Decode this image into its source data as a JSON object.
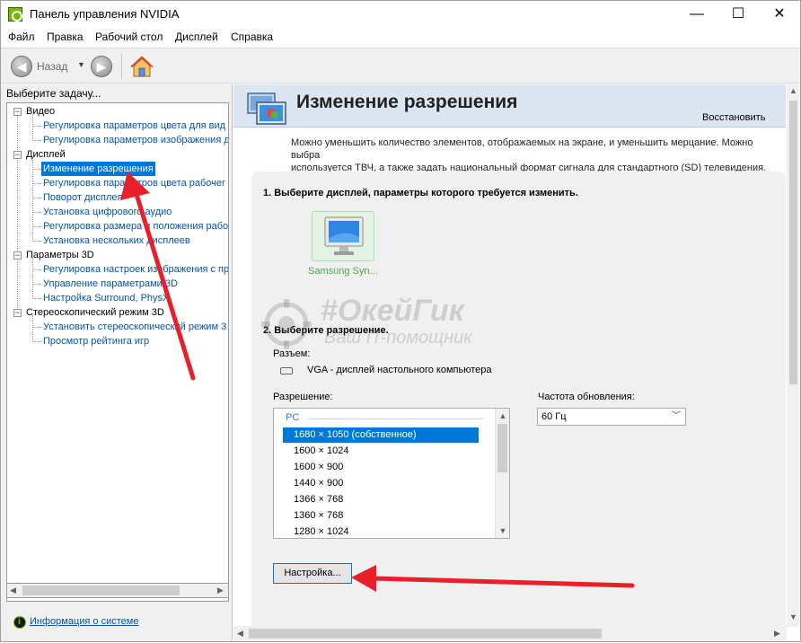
{
  "window": {
    "title": "Панель управления NVIDIA",
    "minimize_glyph": "—",
    "maximize_glyph": "☐",
    "close_glyph": "✕"
  },
  "menu": [
    "Файл",
    "Правка",
    "Рабочий стол",
    "Дисплей",
    "Справка"
  ],
  "toolbar": {
    "back_label": "Назад",
    "back_glyph": "◀",
    "forward_glyph": "▶",
    "dropdown_glyph": "▼"
  },
  "left_pane": {
    "task_label": "Выберите задачу...",
    "tree": [
      {
        "label": "Видео",
        "items": [
          "Регулировка параметров цвета для вид",
          "Регулировка параметров изображения д"
        ]
      },
      {
        "label": "Дисплей",
        "items": [
          "Изменение разрешения",
          "Регулировка параметров цвета рабочег",
          "Поворот дисплея",
          "Установка цифрового аудио",
          "Регулировка размера и положения рабо",
          "Установка нескольких дисплеев"
        ]
      },
      {
        "label": "Параметры 3D",
        "items": [
          "Регулировка настроек изображения с пр",
          "Управление параметрами 3D",
          "Настройка Surround, PhysX"
        ]
      },
      {
        "label": "Стереоскопический режим 3D",
        "items": [
          "Установить стереоскопический режим 3",
          "Просмотр рейтинга игр"
        ]
      }
    ],
    "selected_item": "Изменение разрешения",
    "toggle_glyph": "−",
    "system_info_link": "Информация о системе"
  },
  "page": {
    "title": "Изменение разрешения",
    "restore_label": "Восстановить",
    "description_line1": "Можно уменьшить количество элементов, отображаемых на экране, и уменьшить мерцание. Можно выбра",
    "description_line2": "используется ТВЧ, а также задать национальный формат сигнала для стандартного (SD) телевидения.",
    "step1_label": "1. Выберите дисплей, параметры которого требуется изменить.",
    "display_name": "Samsung Syn...",
    "step2_label": "2. Выберите разрешение.",
    "connector_label": "Разъем:",
    "connector_value": "VGA - дисплей настольного компьютера",
    "resolution_label": "Разрешение:",
    "resolution_group": "PC",
    "resolutions": [
      "1680 × 1050 (собственное)",
      "1600 × 1024",
      "1600 × 900",
      "1440 × 900",
      "1366 × 768",
      "1360 × 768",
      "1280 × 1024"
    ],
    "selected_resolution": "1680 × 1050 (собственное)",
    "refresh_label": "Частота обновления:",
    "refresh_value": "60 Гц",
    "settings_button": "Настройка..."
  },
  "watermark": {
    "line1": "#ОкейГик",
    "line2": "Ваш IT-помощник"
  },
  "colors": {
    "nvidia_green": "#76b900",
    "selection_blue": "#0078d7",
    "link_blue": "#0054b5",
    "annotation_red": "#e8202a",
    "header_bg": "#dce6f2"
  }
}
